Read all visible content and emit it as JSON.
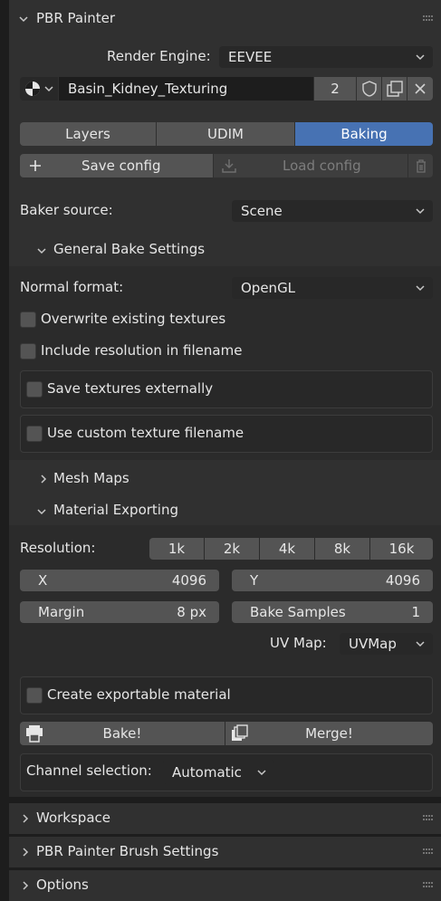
{
  "panel": {
    "title": "PBR Painter",
    "render_engine_label": "Render Engine:",
    "render_engine_value": "EEVEE",
    "material_name": "Basin_Kidney_Texturing",
    "material_users": "2"
  },
  "tabs": [
    {
      "label": "Layers",
      "active": false
    },
    {
      "label": "UDIM",
      "active": false
    },
    {
      "label": "Baking",
      "active": true
    }
  ],
  "config": {
    "save_label": "Save config",
    "load_label": "Load config"
  },
  "baker_source": {
    "label": "Baker source:",
    "value": "Scene"
  },
  "general_bake": {
    "title": "General Bake Settings",
    "normal_format_label": "Normal format:",
    "normal_format_value": "OpenGL",
    "overwrite_label": "Overwrite existing textures",
    "include_res_label": "Include resolution in filename",
    "save_external_label": "Save textures externally",
    "custom_filename_label": "Use custom texture filename"
  },
  "mesh_maps": {
    "title": "Mesh Maps"
  },
  "material_exporting": {
    "title": "Material Exporting",
    "resolution_label": "Resolution:",
    "resolution_presets": [
      "1k",
      "2k",
      "4k",
      "8k",
      "16k"
    ],
    "x_label": "X",
    "x_value": "4096",
    "y_label": "Y",
    "y_value": "4096",
    "margin_label": "Margin",
    "margin_value": "8 px",
    "samples_label": "Bake Samples",
    "samples_value": "1",
    "uvmap_label": "UV Map:",
    "uvmap_value": "UVMap",
    "exportable_label": "Create exportable material",
    "bake_label": "Bake!",
    "merge_label": "Merge!",
    "channel_label": "Channel selection:",
    "channel_value": "Automatic"
  },
  "collapsed_panels": {
    "workspace": "Workspace",
    "brush_settings": "PBR Painter Brush Settings",
    "options": "Options"
  },
  "colors": {
    "accent": "#4772b3",
    "panel": "#303030",
    "button": "#545454",
    "field": "#1d1d1d"
  }
}
